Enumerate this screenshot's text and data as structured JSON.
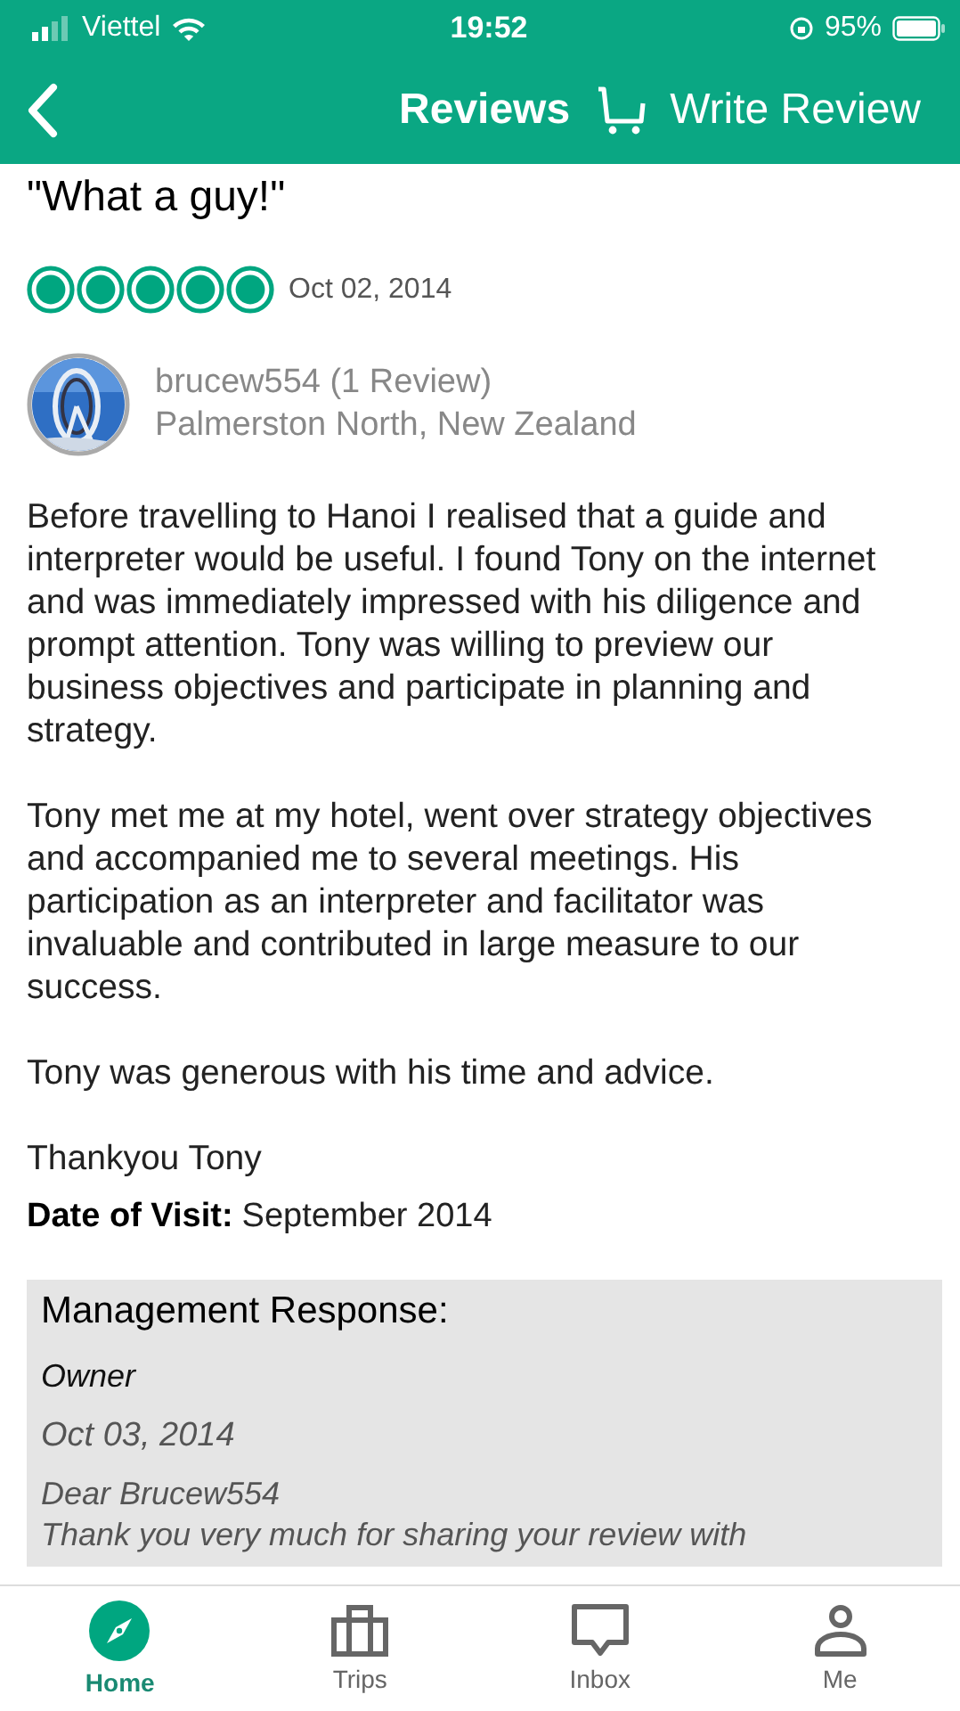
{
  "status_bar": {
    "carrier": "Viettel",
    "time": "19:52",
    "battery": "95%"
  },
  "header": {
    "title": "Reviews",
    "action": "Write Review"
  },
  "review": {
    "title": "\"What a guy!\"",
    "stars": 5,
    "date": "Oct 02, 2014",
    "reviewer": {
      "name": "brucew554 (1 Review)",
      "location": "Palmerston North, New Zealand"
    },
    "paragraphs": [
      "Before travelling to Hanoi I realised that a guide and interpreter would be useful. I found Tony on the internet and was immediately impressed with his diligence and prompt attention. Tony was willing to preview our business objectives and participate in planning and strategy.",
      "Tony met me at my hotel, went over strategy objectives and accompanied me to several meetings. His participation as an interpreter and facilitator was invaluable and contributed in large measure to our success.",
      "Tony was generous with his time and advice.",
      "Thankyou Tony"
    ],
    "visit_label": "Date of Visit:",
    "visit_date": "September 2014"
  },
  "management_response": {
    "heading": "Management Response:",
    "author": "Owner",
    "date": "Oct 03, 2014",
    "lines": [
      "Dear Brucew554",
      "Thank you very much for sharing your review with"
    ]
  },
  "nav": [
    {
      "label": "Home",
      "selected": true
    },
    {
      "label": "Trips",
      "selected": false
    },
    {
      "label": "Inbox",
      "selected": false
    },
    {
      "label": "Me",
      "selected": false
    }
  ]
}
